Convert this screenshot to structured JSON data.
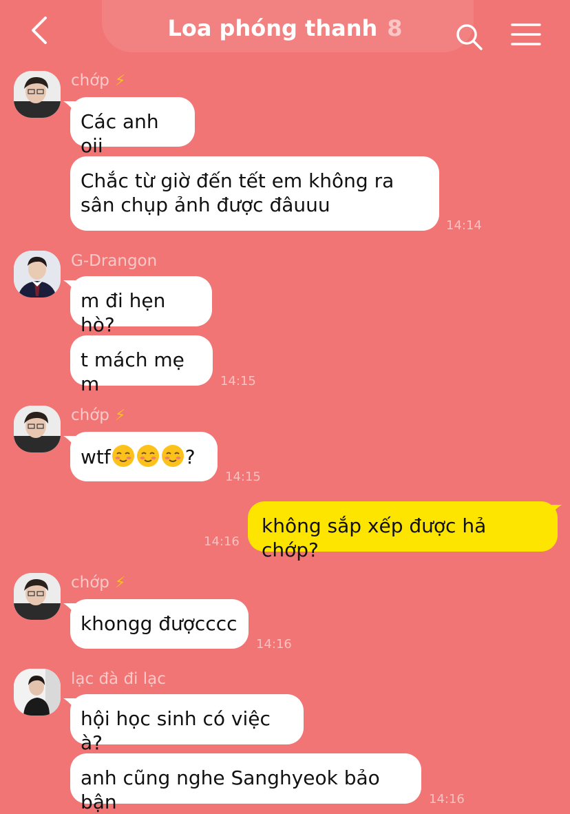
{
  "header": {
    "title": "Loa phóng thanh",
    "member_count": "8",
    "back_icon": "chevron-left-icon",
    "search_icon": "search-icon",
    "menu_icon": "hamburger-menu-icon"
  },
  "messages": {
    "g1": {
      "sender": "chớp",
      "bolt": "⚡",
      "b1": "Các anh oii",
      "b2": "Chắc từ giờ đến tết em không ra sân chụp ảnh được đâuuu",
      "time": "14:14"
    },
    "g2": {
      "sender": "G-Drangon",
      "b1": "m đi hẹn hò?",
      "b2": "t mách mẹ m",
      "time": "14:15"
    },
    "g3": {
      "sender": "chớp",
      "bolt": "⚡",
      "b1_prefix": "wtf",
      "b1_suffix": "?",
      "emoji_count": 3,
      "time": "14:15"
    },
    "mine": {
      "text": "không sắp xếp được hả chớp?",
      "time": "14:16"
    },
    "g4": {
      "sender": "chớp",
      "bolt": "⚡",
      "b1": "khongg đượcccc",
      "time": "14:16"
    },
    "g5": {
      "sender": "lạc đà đi lạc",
      "b1": "hội học sinh có việc à?",
      "b2": "anh cũng nghe Sanghyeok bảo bận",
      "time": "14:16"
    }
  },
  "colors": {
    "background": "#F17575",
    "mine_bubble": "#FEE500",
    "other_bubble": "#FFFFFF"
  }
}
